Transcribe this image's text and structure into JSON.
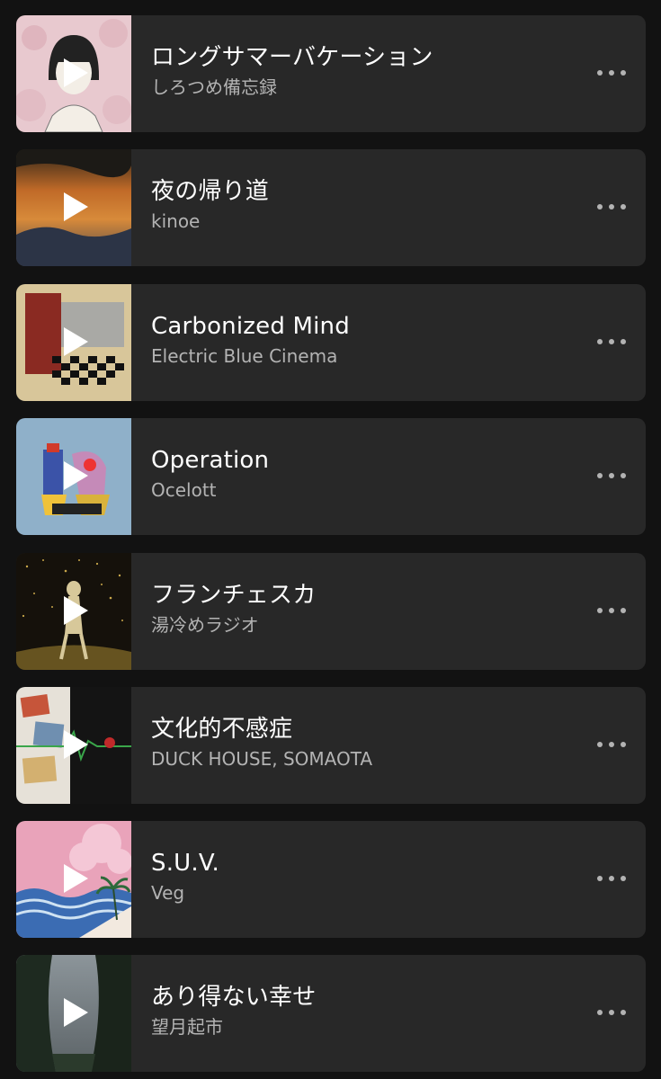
{
  "tracks": [
    {
      "title": "ロングサマーバケーション",
      "artist": "しろつめ備忘録",
      "art_icon": "girl-sketch-pink-art",
      "play_icon": "play-icon",
      "more_icon": "more-options-icon"
    },
    {
      "title": "夜の帰り道",
      "artist": "kinoe",
      "art_icon": "orange-night-landscape-art",
      "play_icon": "play-icon",
      "more_icon": "more-options-icon"
    },
    {
      "title": "Carbonized Mind",
      "artist": "Electric Blue Cinema",
      "art_icon": "checkerboard-room-art",
      "play_icon": "play-icon",
      "more_icon": "more-options-icon"
    },
    {
      "title": "Operation",
      "artist": "Ocelott",
      "art_icon": "blue-robot-figures-art",
      "play_icon": "play-icon",
      "more_icon": "more-options-icon"
    },
    {
      "title": "フランチェスカ",
      "artist": "湯冷めラジオ",
      "art_icon": "golden-dancer-art",
      "play_icon": "play-icon",
      "more_icon": "more-options-icon"
    },
    {
      "title": "文化的不感症",
      "artist": "DUCK HOUSE, SOMAOTA",
      "art_icon": "collage-heartbeat-art",
      "play_icon": "play-icon",
      "more_icon": "more-options-icon"
    },
    {
      "title": "S.U.V.",
      "artist": "Veg",
      "art_icon": "pink-wave-palm-art",
      "play_icon": "play-icon",
      "more_icon": "more-options-icon"
    },
    {
      "title": "あり得ない幸せ",
      "artist": "望月起市",
      "art_icon": "forest-sky-art",
      "play_icon": "play-icon",
      "more_icon": "more-options-icon"
    }
  ],
  "colors": {
    "background": "#121212",
    "card": "#282828",
    "title": "#ffffff",
    "artist": "#b3b3b3",
    "icon": "#b3b3b3"
  }
}
